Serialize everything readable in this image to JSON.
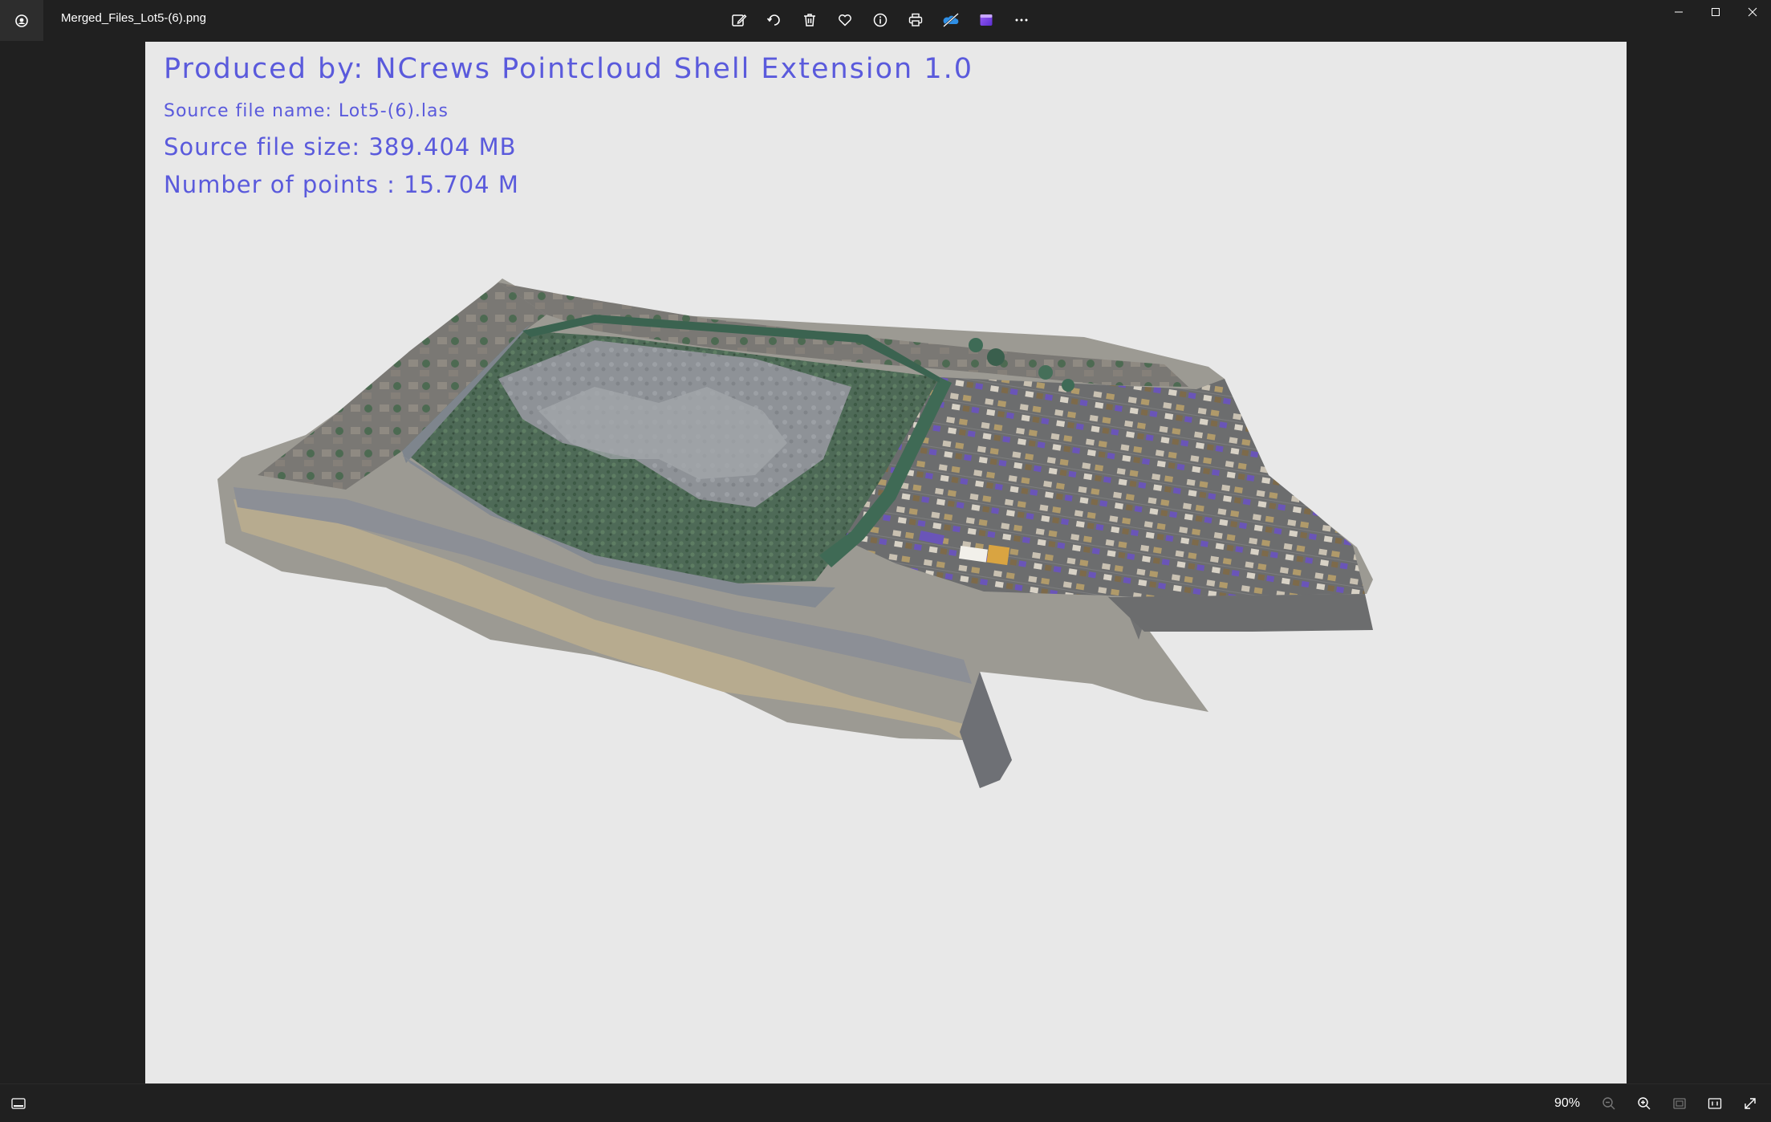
{
  "window": {
    "file_name": "Merged_Files_Lot5-(6).png",
    "toolbar_icons": [
      "edit-image-icon",
      "rotate-icon",
      "delete-icon",
      "favorite-icon",
      "info-icon",
      "print-icon",
      "onedrive-icon",
      "clipchamp-icon",
      "more-icon"
    ]
  },
  "overlay": {
    "produced_by": "Produced by: NCrews Pointcloud Shell Extension 1.0",
    "source_name": "Source file name: Lot5-(6).las",
    "source_size": "Source file size: 389.404 MB",
    "points": "Number of points : 15.704 M"
  },
  "status": {
    "zoom": "90%"
  },
  "colors": {
    "chrome": "#202020",
    "canvas": "#e8e8e8",
    "overlay_text": "#5a5adc"
  }
}
